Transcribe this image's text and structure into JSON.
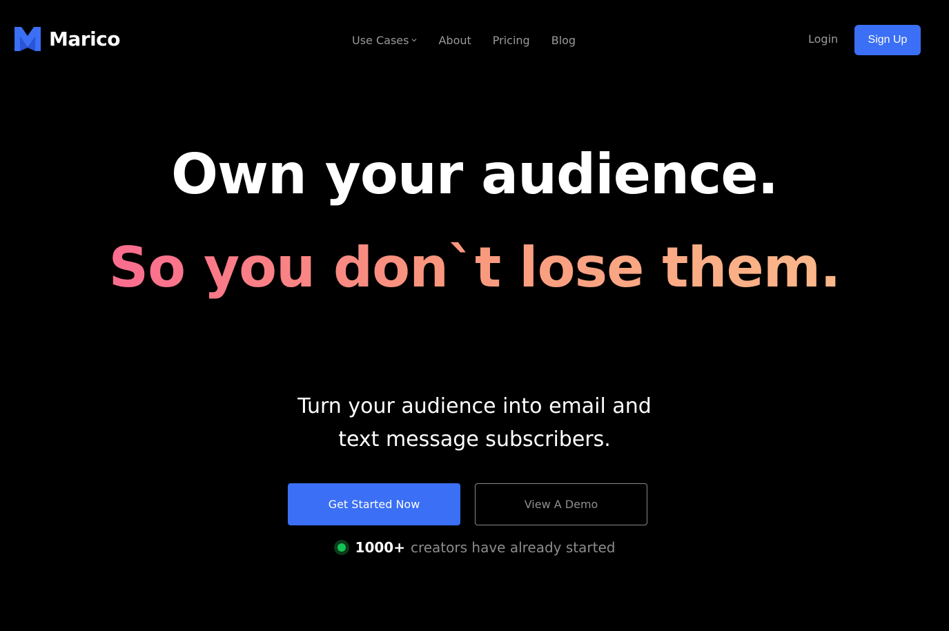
{
  "brand": {
    "name": "Marico",
    "logo_icon": "marico-m-logo-icon",
    "logo_color": "#3b6ff5"
  },
  "nav": {
    "items": [
      {
        "label": "Use Cases",
        "has_dropdown": true
      },
      {
        "label": "About"
      },
      {
        "label": "Pricing"
      },
      {
        "label": "Blog"
      }
    ],
    "login_label": "Login",
    "signup_label": "Sign Up"
  },
  "hero": {
    "headline_line1": "Own your audience.",
    "headline_line2": "So you don`t lose them.",
    "subhead_line1": "Turn your audience into email and",
    "subhead_line2": "text message subscribers.",
    "primary_cta": "Get Started Now",
    "secondary_cta": "View A Demo",
    "social_proof_count": "1000+",
    "social_proof_text": "creators have already started"
  },
  "colors": {
    "background": "#000000",
    "accent": "#3b6ff5",
    "gradient_start": "#fa6c8e",
    "gradient_end": "#fbb88a",
    "status_green": "#14c453"
  }
}
